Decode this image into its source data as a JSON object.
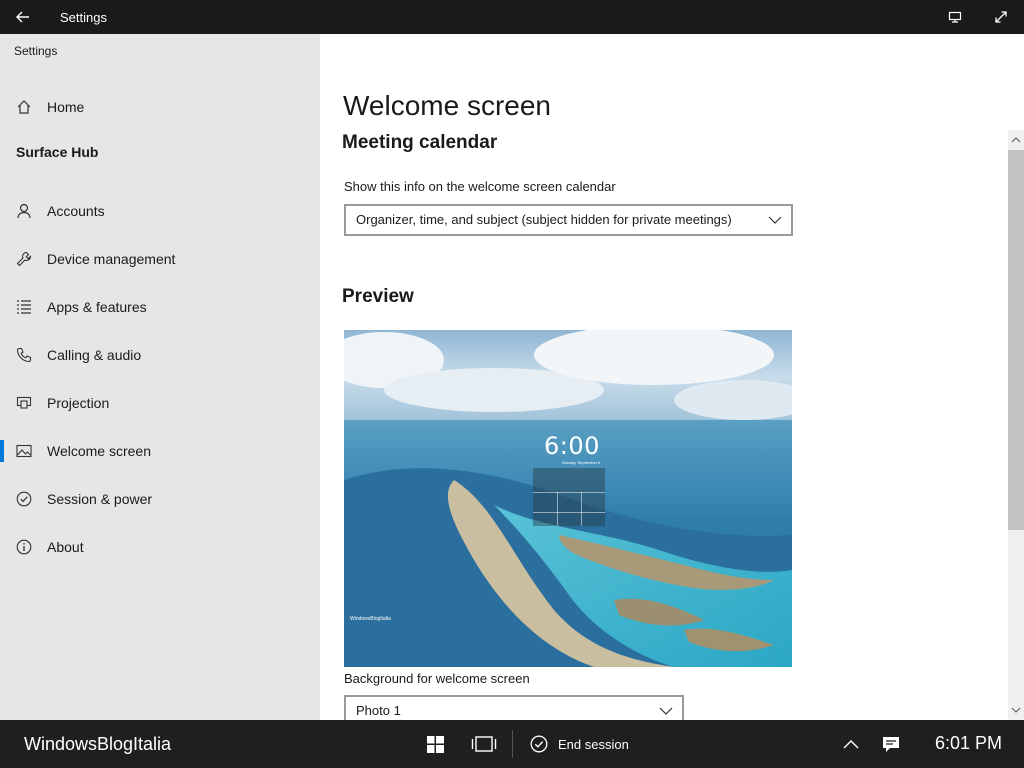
{
  "titlebar": {
    "title": "Settings"
  },
  "sidebar": {
    "app_label": "Settings",
    "home_label": "Home",
    "section_heading": "Surface Hub",
    "items": [
      {
        "label": "Accounts",
        "icon": "person-icon"
      },
      {
        "label": "Device management",
        "icon": "wrench-icon"
      },
      {
        "label": "Apps & features",
        "icon": "list-icon"
      },
      {
        "label": "Calling & audio",
        "icon": "phone-icon"
      },
      {
        "label": "Projection",
        "icon": "projection-icon"
      },
      {
        "label": "Welcome screen",
        "icon": "image-icon",
        "selected": true
      },
      {
        "label": "Session & power",
        "icon": "check-circle-icon"
      },
      {
        "label": "About",
        "icon": "info-icon"
      }
    ]
  },
  "main": {
    "page_title": "Welcome screen",
    "meeting_calendar_heading": "Meeting calendar",
    "calendar_info_label": "Show this info on the welcome screen calendar",
    "calendar_info_value": "Organizer, time, and subject (subject hidden for private meetings)",
    "preview_heading": "Preview",
    "preview": {
      "clock": "6:00",
      "date": "Sunday, September 6",
      "brand": "WindowsBlogItalia"
    },
    "background_label": "Background for welcome screen",
    "background_value": "Photo 1"
  },
  "taskbar": {
    "owner_label": "WindowsBlogItalia",
    "end_session_label": "End session",
    "time": "6:01 PM"
  },
  "colors": {
    "accent": "#0078d7",
    "titlebar": "#1a1a1a",
    "sidebar": "#e6e6e6",
    "taskbar": "#1f1f1f"
  }
}
